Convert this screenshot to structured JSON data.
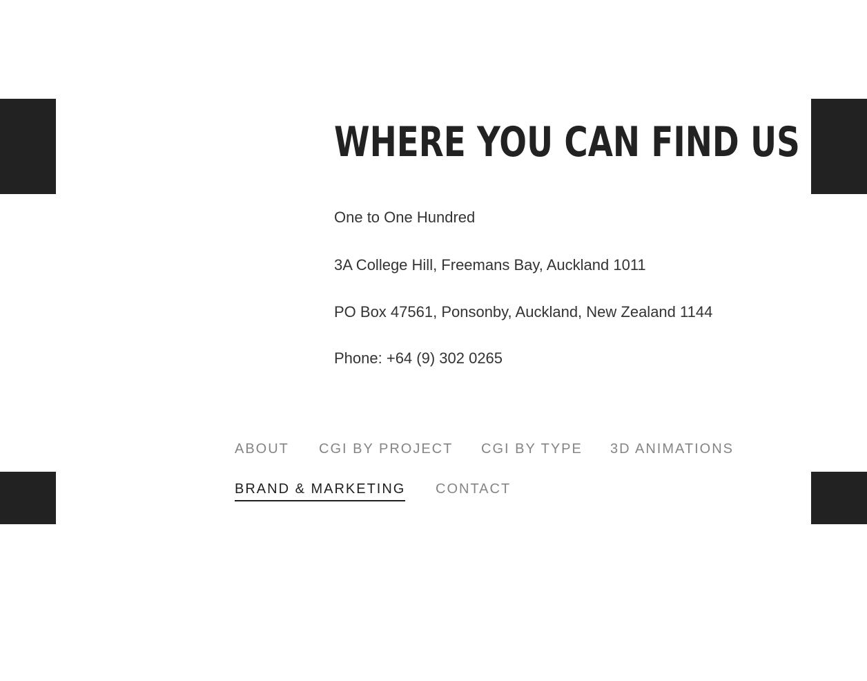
{
  "contact": {
    "title": "WHERE YOU CAN FIND US",
    "lines": [
      "One to One Hundred",
      "3A College Hill, Freemans Bay, Auckland 1011",
      "PO Box 47561, Ponsonby, Auckland, New Zealand 1144",
      "Phone: +64 (9) 302 0265"
    ]
  },
  "nav": {
    "items": [
      {
        "label": "ABOUT",
        "active": false
      },
      {
        "label": "CGI BY PROJECT",
        "active": false
      },
      {
        "label": "CGI BY TYPE",
        "active": false
      },
      {
        "label": "3D ANIMATIONS",
        "active": false
      },
      {
        "label": "BRAND & MARKETING",
        "active": true
      },
      {
        "label": "CONTACT",
        "active": false
      }
    ]
  },
  "colors": {
    "text_dark": "#222222",
    "nav_inactive": "#858585",
    "nav_active": "#1e1e1e",
    "block": "#222222",
    "background": "#ffffff"
  }
}
